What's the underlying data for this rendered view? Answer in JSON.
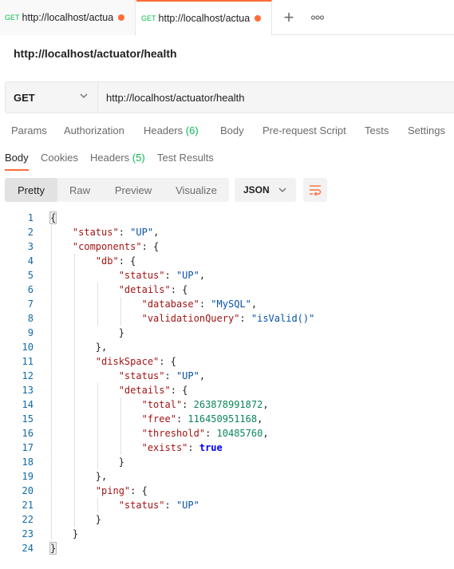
{
  "tabs": [
    {
      "method": "GET",
      "url": "http://localhost/actuator/health",
      "unsaved": true,
      "active": false
    },
    {
      "method": "GET",
      "url": "http://localhost/actuator/health",
      "unsaved": true,
      "active": true
    }
  ],
  "tab_actions": {
    "new_tab": "+",
    "more": "∘∘∘"
  },
  "request": {
    "title": "http://localhost/actuator/health",
    "method": "GET",
    "url": "http://localhost/actuator/health"
  },
  "request_tabs": [
    {
      "label": "Params"
    },
    {
      "label": "Authorization"
    },
    {
      "label": "Headers",
      "count": "(6)"
    },
    {
      "label": "Body"
    },
    {
      "label": "Pre-request Script"
    },
    {
      "label": "Tests"
    },
    {
      "label": "Settings"
    }
  ],
  "response_tabs": [
    {
      "label": "Body",
      "active": true
    },
    {
      "label": "Cookies"
    },
    {
      "label": "Headers",
      "count": "(5)"
    },
    {
      "label": "Test Results"
    }
  ],
  "format": {
    "options": [
      "Pretty",
      "Raw",
      "Preview",
      "Visualize"
    ],
    "selected": "Pretty",
    "language": "JSON",
    "wrap_icon": "wrap-lines-icon"
  },
  "code": {
    "line_numbers": [
      "1",
      "2",
      "3",
      "4",
      "5",
      "6",
      "7",
      "8",
      "9",
      "10",
      "11",
      "12",
      "13",
      "14",
      "15",
      "16",
      "17",
      "18",
      "19",
      "20",
      "21",
      "22",
      "23",
      "24"
    ],
    "lines": [
      "{",
      "    \"status\": \"UP\",",
      "    \"components\": {",
      "        \"db\": {",
      "            \"status\": \"UP\",",
      "            \"details\": {",
      "                \"database\": \"MySQL\",",
      "                \"validationQuery\": \"isValid()\"",
      "            }",
      "        },",
      "        \"diskSpace\": {",
      "            \"status\": \"UP\",",
      "            \"details\": {",
      "                \"total\": 263878991872,",
      "                \"free\": 116450951168,",
      "                \"threshold\": 10485760,",
      "                \"exists\": true",
      "            }",
      "        },",
      "        \"ping\": {",
      "            \"status\": \"UP\"",
      "        }",
      "    }",
      "}"
    ]
  },
  "colors": {
    "accent": "#ff6c37",
    "method_get": "#0cbb52",
    "json_key": "#a31515",
    "json_string": "#0451a5",
    "json_number": "#098658",
    "json_boolean": "#0000ff",
    "line_number": "#0f6aa8"
  }
}
